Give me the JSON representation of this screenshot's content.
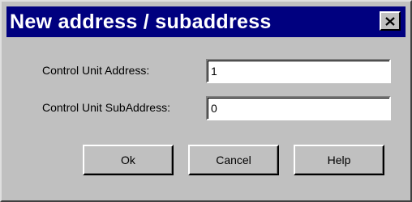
{
  "window": {
    "title": "New address / subaddress",
    "title_bar_color": "#00007f",
    "close_icon": "close-icon"
  },
  "form": {
    "address_label": "Control Unit Address:",
    "address_value": "1",
    "subaddress_label": "Control Unit SubAddress:",
    "subaddress_value": "0"
  },
  "buttons": {
    "ok": "Ok",
    "cancel": "Cancel",
    "help": "Help"
  }
}
